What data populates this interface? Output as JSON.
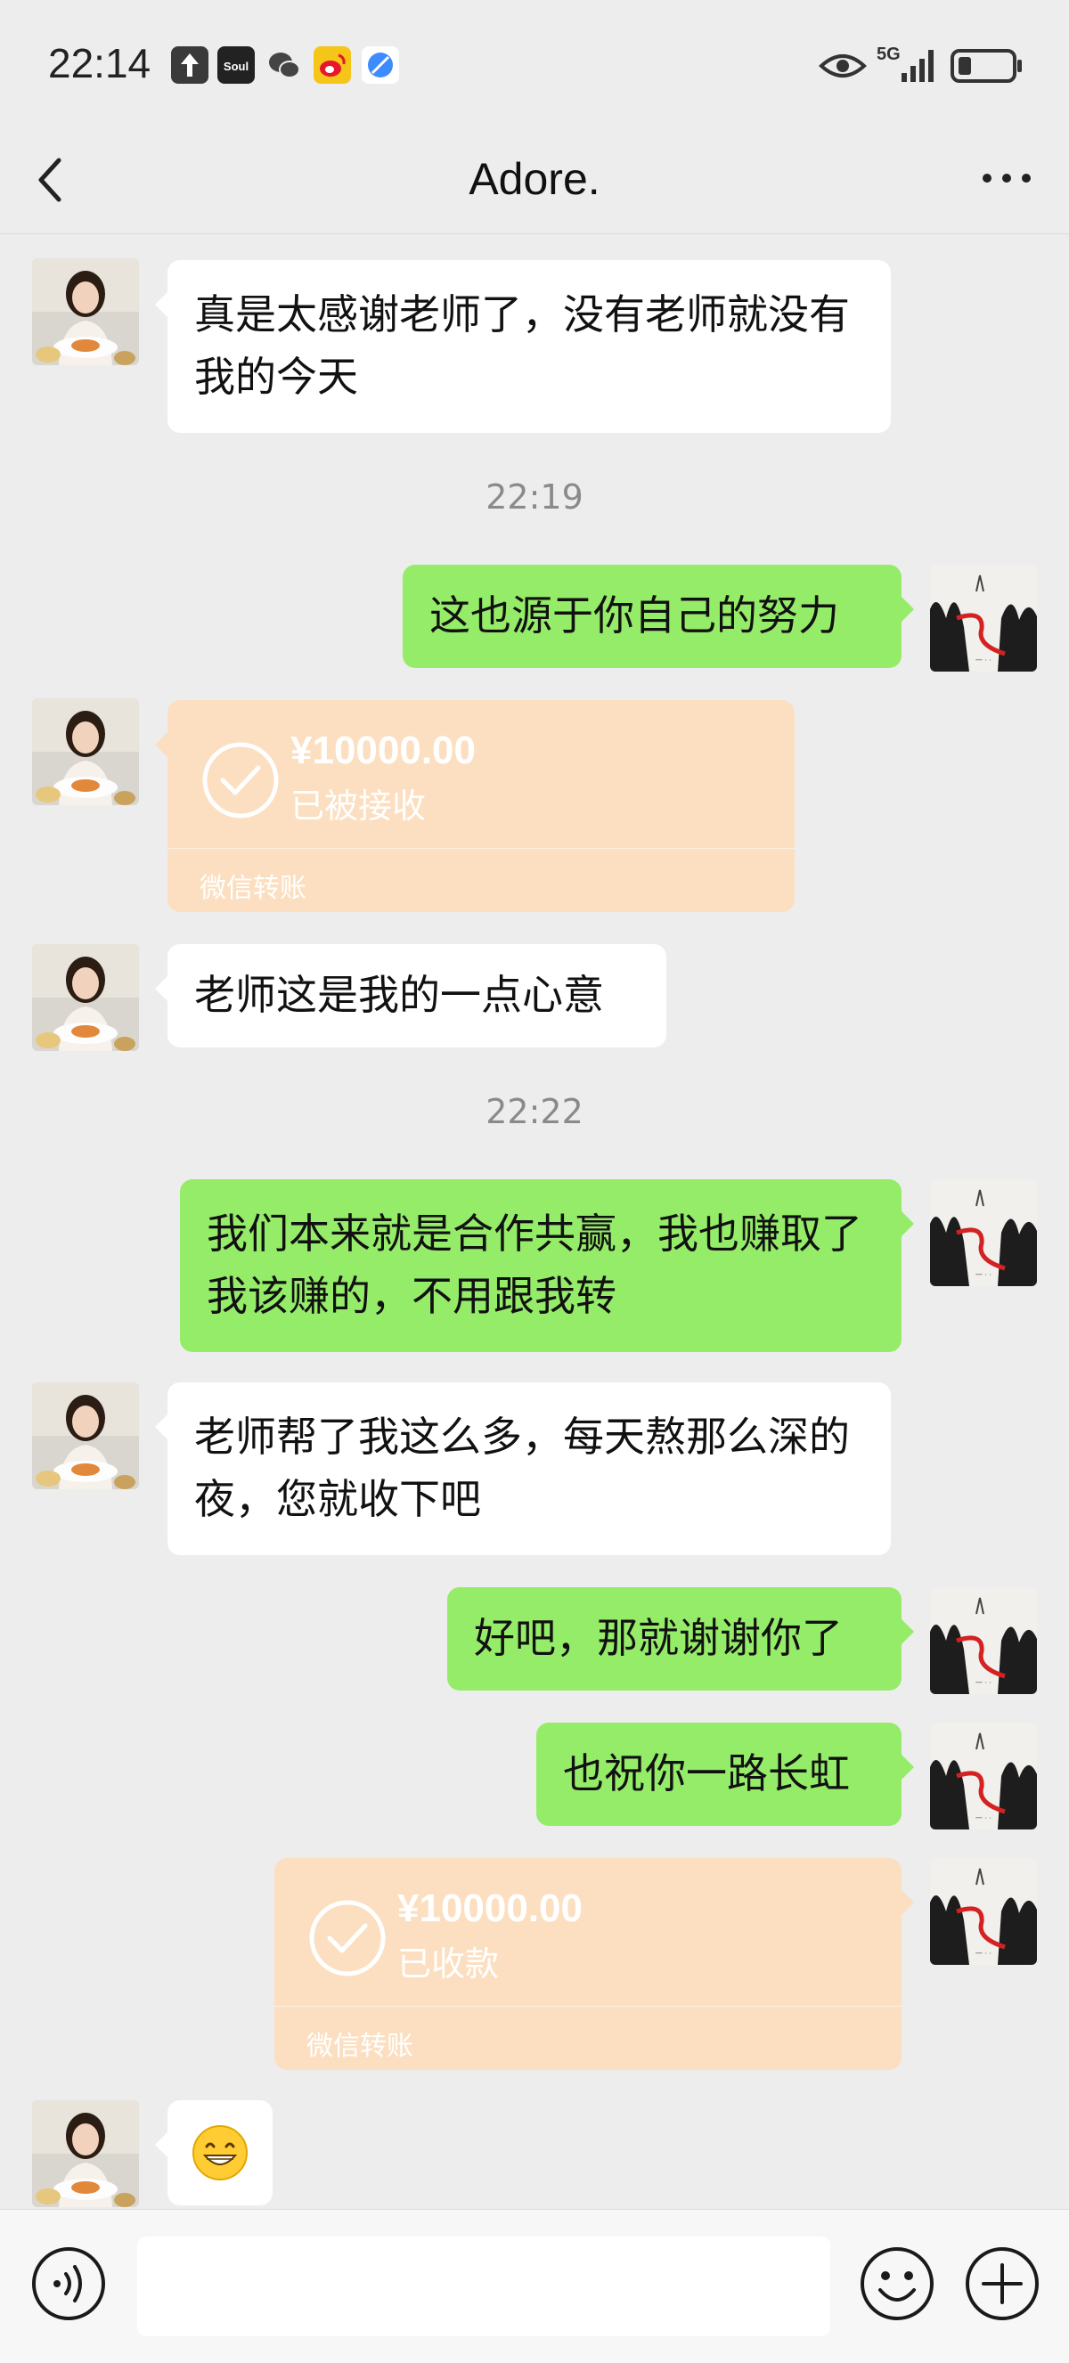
{
  "status_bar": {
    "time": "22:14",
    "network": "5G",
    "app_icons": [
      "upload-icon",
      "soul-app-icon",
      "wechat-icon",
      "weibo-icon",
      "browser-icon"
    ]
  },
  "header": {
    "title": "Adore."
  },
  "messages": [
    {
      "side": "left",
      "type": "text",
      "text": "真是太感谢老师了，没有老师就没有我的今天"
    },
    {
      "type": "time",
      "text": "22:19"
    },
    {
      "side": "right",
      "type": "text",
      "text": "这也源于你自己的努力"
    },
    {
      "side": "left",
      "type": "transfer",
      "amount": "¥10000.00",
      "status": "已被接收",
      "footer": "微信转账"
    },
    {
      "side": "left",
      "type": "text",
      "text": "老师这是我的一点心意"
    },
    {
      "type": "time",
      "text": "22:22"
    },
    {
      "side": "right",
      "type": "text",
      "text": "我们本来就是合作共赢，我也赚取了我该赚的，不用跟我转"
    },
    {
      "side": "left",
      "type": "text",
      "text": "老师帮了我这么多，每天熬那么深的夜，您就收下吧"
    },
    {
      "side": "right",
      "type": "text",
      "text": "好吧，那就谢谢你了"
    },
    {
      "side": "right",
      "type": "text",
      "text": "也祝你一路长虹"
    },
    {
      "side": "right",
      "type": "transfer",
      "amount": "¥10000.00",
      "status": "已收款",
      "footer": "微信转账"
    },
    {
      "side": "left",
      "type": "emoji",
      "emoji": "grinning-face-icon"
    }
  ],
  "colors": {
    "background": "#ededed",
    "sent_bubble": "#95ec69",
    "received_bubble": "#ffffff",
    "transfer_bubble": "#fcdfc1"
  }
}
